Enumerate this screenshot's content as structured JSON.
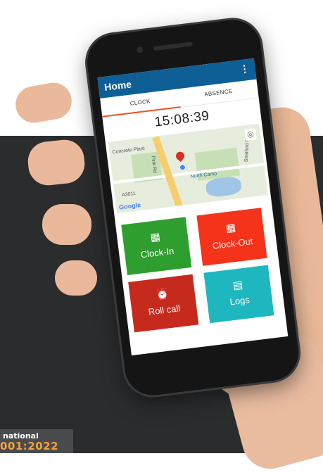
{
  "app": {
    "title": "Home",
    "menu_icon": "⋮"
  },
  "tabs": [
    {
      "label": "CLOCK",
      "active": true
    },
    {
      "label": "ABSENCE",
      "active": false
    }
  ],
  "clock": {
    "time": "15:08:39"
  },
  "map": {
    "labels": [
      "Concrete Plant",
      "North Camp",
      "A3011",
      "Pink Rd",
      "Stratford Rd"
    ],
    "attribution": "Google"
  },
  "tiles": [
    {
      "label": "Clock-In",
      "icon": "calendar-icon",
      "color": "#2e9e2e"
    },
    {
      "label": "Clock-Out",
      "icon": "calendar-icon",
      "color": "#f5331b"
    },
    {
      "label": "Roll call",
      "icon": "alarm-icon",
      "color": "#c62a1c"
    },
    {
      "label": "Logs",
      "icon": "clipboard-icon",
      "color": "#1fb7bf"
    }
  ],
  "badge": {
    "line1": "national",
    "line2": "001:2022"
  }
}
